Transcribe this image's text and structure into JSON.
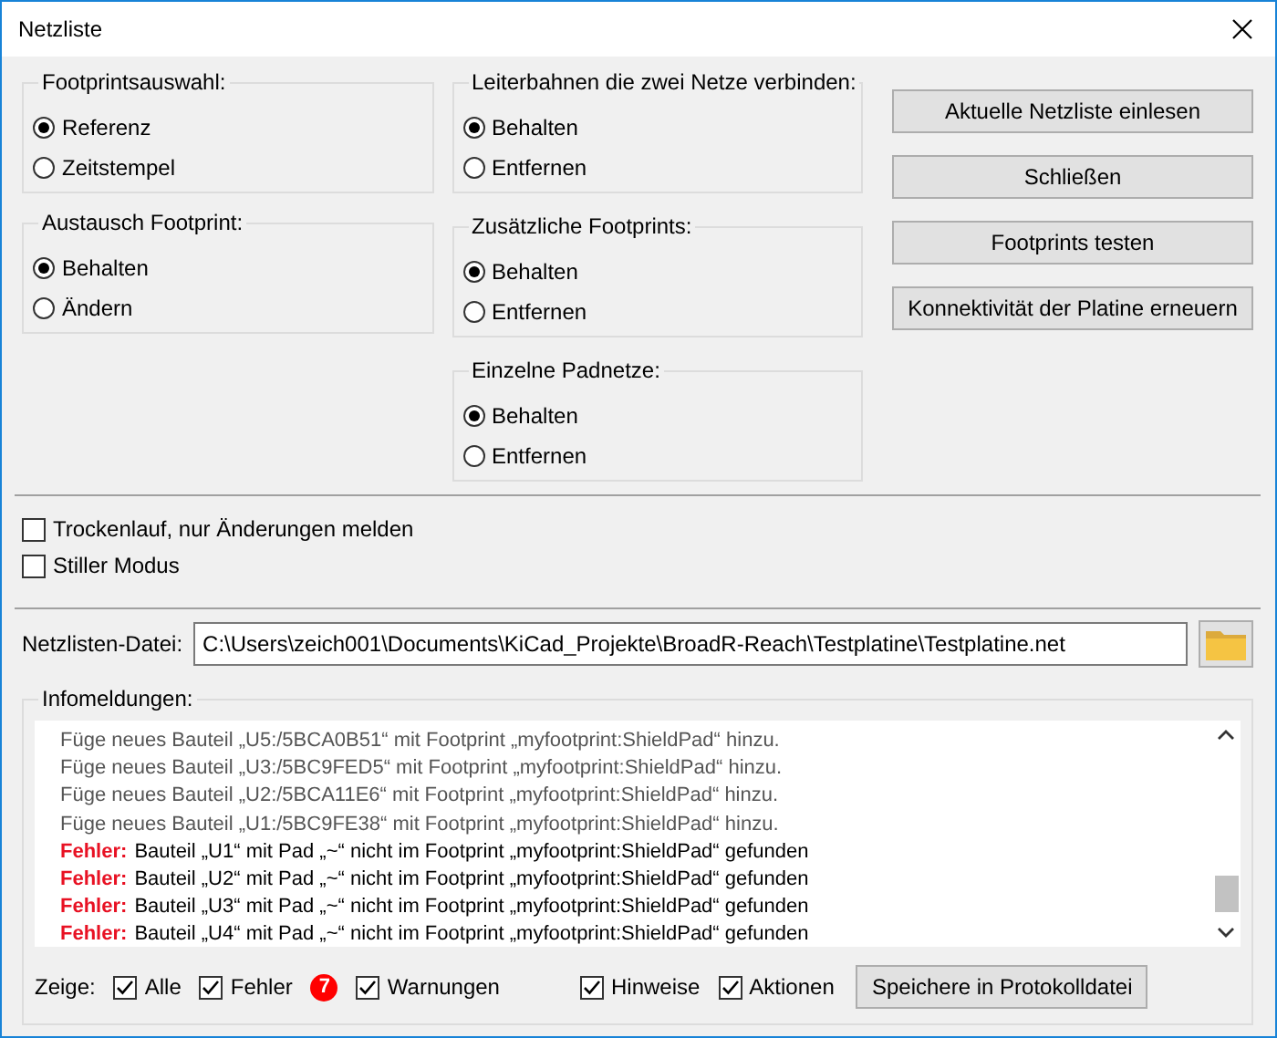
{
  "window": {
    "title": "Netzliste"
  },
  "left_groups": [
    {
      "title": "Footprintsauswahl:",
      "options": [
        {
          "label": "Referenz",
          "selected": true
        },
        {
          "label": "Zeitstempel",
          "selected": false
        }
      ]
    },
    {
      "title": "Austausch Footprint:",
      "options": [
        {
          "label": "Behalten",
          "selected": true
        },
        {
          "label": "Ändern",
          "selected": false
        }
      ]
    }
  ],
  "middle_groups": [
    {
      "title": "Leiterbahnen die zwei Netze verbinden:",
      "options": [
        {
          "label": "Behalten",
          "selected": true
        },
        {
          "label": "Entfernen",
          "selected": false
        }
      ]
    },
    {
      "title": "Zusätzliche Footprints:",
      "options": [
        {
          "label": "Behalten",
          "selected": true
        },
        {
          "label": "Entfernen",
          "selected": false
        }
      ]
    },
    {
      "title": "Einzelne Padnetze:",
      "options": [
        {
          "label": "Behalten",
          "selected": true
        },
        {
          "label": "Entfernen",
          "selected": false
        }
      ]
    }
  ],
  "buttons": [
    "Aktuelle Netzliste einlesen",
    "Schließen",
    "Footprints testen",
    "Konnektivität der Platine erneuern"
  ],
  "options": [
    {
      "label": "Trockenlauf, nur Änderungen melden",
      "checked": false
    },
    {
      "label": "Stiller Modus",
      "checked": false
    }
  ],
  "file": {
    "label": "Netzlisten-Datei:",
    "value": "C:\\Users\\zeich001\\Documents\\KiCad_Projekte\\BroadR-Reach\\Testplatine\\Testplatine.net"
  },
  "messages": {
    "title": "Infomeldungen:",
    "lines": [
      {
        "kind": "info",
        "text": "Füge neues Bauteil „U5:/5BCA0B51“ mit Footprint „myfootprint:ShieldPad“ hinzu."
      },
      {
        "kind": "info",
        "text": "Füge neues Bauteil „U3:/5BC9FED5“ mit Footprint „myfootprint:ShieldPad“ hinzu."
      },
      {
        "kind": "info",
        "text": "Füge neues Bauteil „U2:/5BCA11E6“ mit Footprint „myfootprint:ShieldPad“ hinzu."
      },
      {
        "kind": "info",
        "text": "Füge neues Bauteil „U1:/5BC9FE38“ mit Footprint „myfootprint:ShieldPad“ hinzu."
      },
      {
        "kind": "error",
        "prefix": "Fehler:",
        "text": "Bauteil „U1“ mit Pad „~“ nicht im Footprint „myfootprint:ShieldPad“ gefunden"
      },
      {
        "kind": "error",
        "prefix": "Fehler:",
        "text": "Bauteil „U2“ mit Pad „~“ nicht im Footprint „myfootprint:ShieldPad“ gefunden"
      },
      {
        "kind": "error",
        "prefix": "Fehler:",
        "text": "Bauteil „U3“ mit Pad „~“ nicht im Footprint „myfootprint:ShieldPad“ gefunden"
      },
      {
        "kind": "error",
        "prefix": "Fehler:",
        "text": "Bauteil „U4“ mit Pad „~“ nicht im Footprint „myfootprint:ShieldPad“ gefunden"
      }
    ]
  },
  "filter": {
    "label": "Zeige:",
    "items": [
      {
        "label": "Alle",
        "checked": true
      },
      {
        "label": "Fehler",
        "checked": true,
        "badge": "7"
      },
      {
        "label": "Warnungen",
        "checked": true
      },
      {
        "label": "Hinweise",
        "checked": true
      },
      {
        "label": "Aktionen",
        "checked": true
      }
    ],
    "save_button": "Speichere in Protokolldatei"
  }
}
